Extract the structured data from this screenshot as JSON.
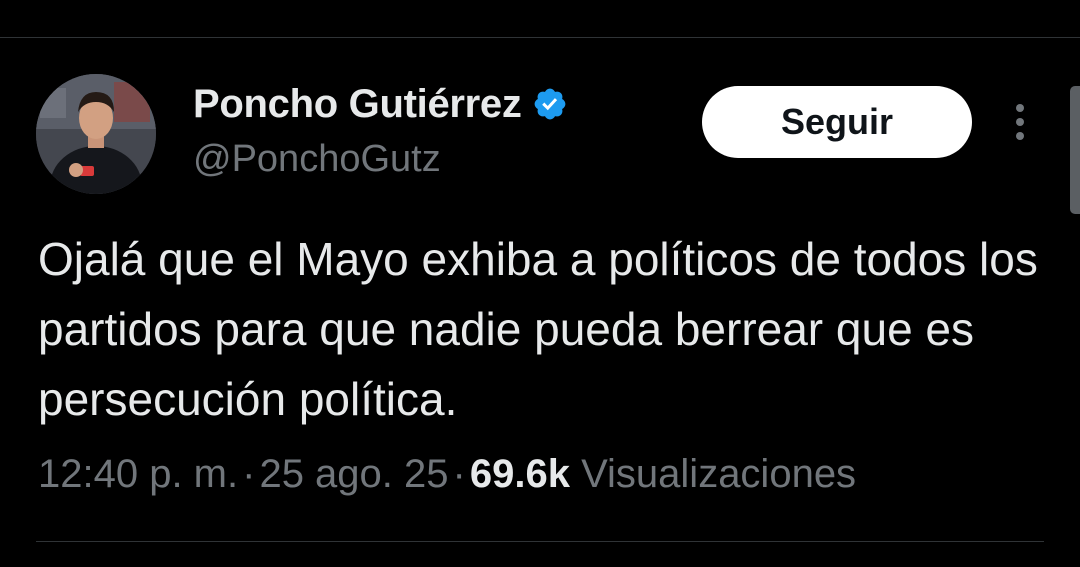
{
  "tweet": {
    "author": {
      "display_name": "Poncho Gutiérrez",
      "handle": "@PonchoGutz",
      "verified": true,
      "verified_badge_color": "#1d9bf0"
    },
    "follow_label": "Seguir",
    "more_icon": "more-vertical-icon",
    "text": "Ojalá que el Mayo exhiba a políticos de todos los partidos para que nadie pueda berrear que es persecución política.",
    "time": "12:40 p. m.",
    "separator": "·",
    "date": "25 ago. 25",
    "views_count": "69.6k",
    "views_label": "Visualizaciones"
  },
  "colors": {
    "background": "#000000",
    "primary_text": "#e7e9ea",
    "secondary_text": "#71767b",
    "divider": "#2f3336",
    "button_bg": "#ffffff",
    "button_text": "#0f1419"
  }
}
